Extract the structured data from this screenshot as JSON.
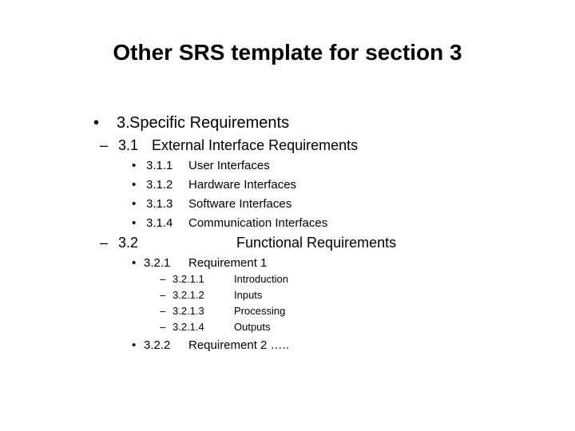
{
  "slide": {
    "title": "Other SRS template for section 3",
    "level1": {
      "bullet": "•",
      "number": "3.",
      "label": "Specific Requirements"
    },
    "section_3_1": {
      "bullet": "–",
      "number": "3.1",
      "label": "External Interface Requirements",
      "items": [
        {
          "bullet": "•",
          "number": "3.1.1",
          "label": "User Interfaces"
        },
        {
          "bullet": "•",
          "number": "3.1.2",
          "label": "Hardware Interfaces"
        },
        {
          "bullet": "•",
          "number": "3.1.3",
          "label": "Software Interfaces"
        },
        {
          "bullet": "•",
          "number": "3.1.4",
          "label": "Communication Interfaces"
        }
      ]
    },
    "section_3_2": {
      "bullet": "–",
      "number": "3.2",
      "label": "Functional Requirements",
      "req1": {
        "bullet": "•",
        "number": "3.2.1",
        "label": "Requirement 1",
        "items": [
          {
            "bullet": "–",
            "number": "3.2.1.1",
            "label": "Introduction"
          },
          {
            "bullet": "–",
            "number": "3.2.1.2",
            "label": "Inputs"
          },
          {
            "bullet": "–",
            "number": "3.2.1.3",
            "label": "Processing"
          },
          {
            "bullet": "–",
            "number": "3.2.1.4",
            "label": "Outputs"
          }
        ]
      },
      "req2": {
        "bullet": "•",
        "number": "3.2.2",
        "label": "Requirement 2 ….."
      }
    }
  }
}
